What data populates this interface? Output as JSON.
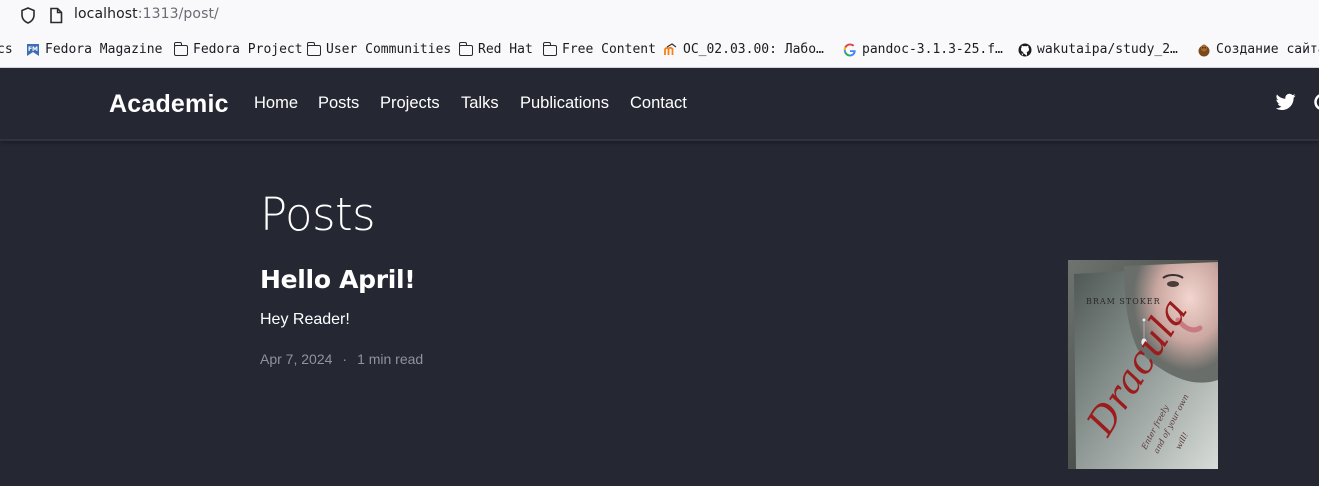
{
  "browser": {
    "url_host": "localhost",
    "url_rest": ":1313/post/"
  },
  "bookmarks": [
    {
      "label": "cs",
      "icon": "truncated"
    },
    {
      "label": "Fedora Magazine",
      "icon": "fedora-magazine-icon"
    },
    {
      "label": "Fedora Project",
      "icon": "folder-icon"
    },
    {
      "label": "User Communities",
      "icon": "folder-icon"
    },
    {
      "label": "Red Hat",
      "icon": "folder-icon"
    },
    {
      "label": "Free Content",
      "icon": "folder-icon"
    },
    {
      "label": "OC_02.03.00: Лабо…",
      "icon": "moodle-icon"
    },
    {
      "label": "pandoc-3.1.3-25.f…",
      "icon": "google-icon"
    },
    {
      "label": "wakutaipa/study_2…",
      "icon": "github-icon"
    },
    {
      "label": "Создание сайта",
      "icon": "hugo-icon"
    }
  ],
  "site": {
    "brand": "Academic",
    "nav": [
      "Home",
      "Posts",
      "Projects",
      "Talks",
      "Publications",
      "Contact"
    ]
  },
  "main": {
    "page_title": "Posts",
    "post": {
      "title": "Hello April!",
      "summary": "Hey Reader!",
      "date": "Apr 7, 2024",
      "separator": "·",
      "reading_time": "1 min read",
      "image_alt": "Dracula book cover",
      "image_text": {
        "author": "BRAM STOKER",
        "title": "Dracula",
        "tagline": "Enter freely and of your own will!"
      }
    }
  },
  "colors": {
    "background": "#252733",
    "text": "#ffffff",
    "meta": "#8e93a0"
  }
}
